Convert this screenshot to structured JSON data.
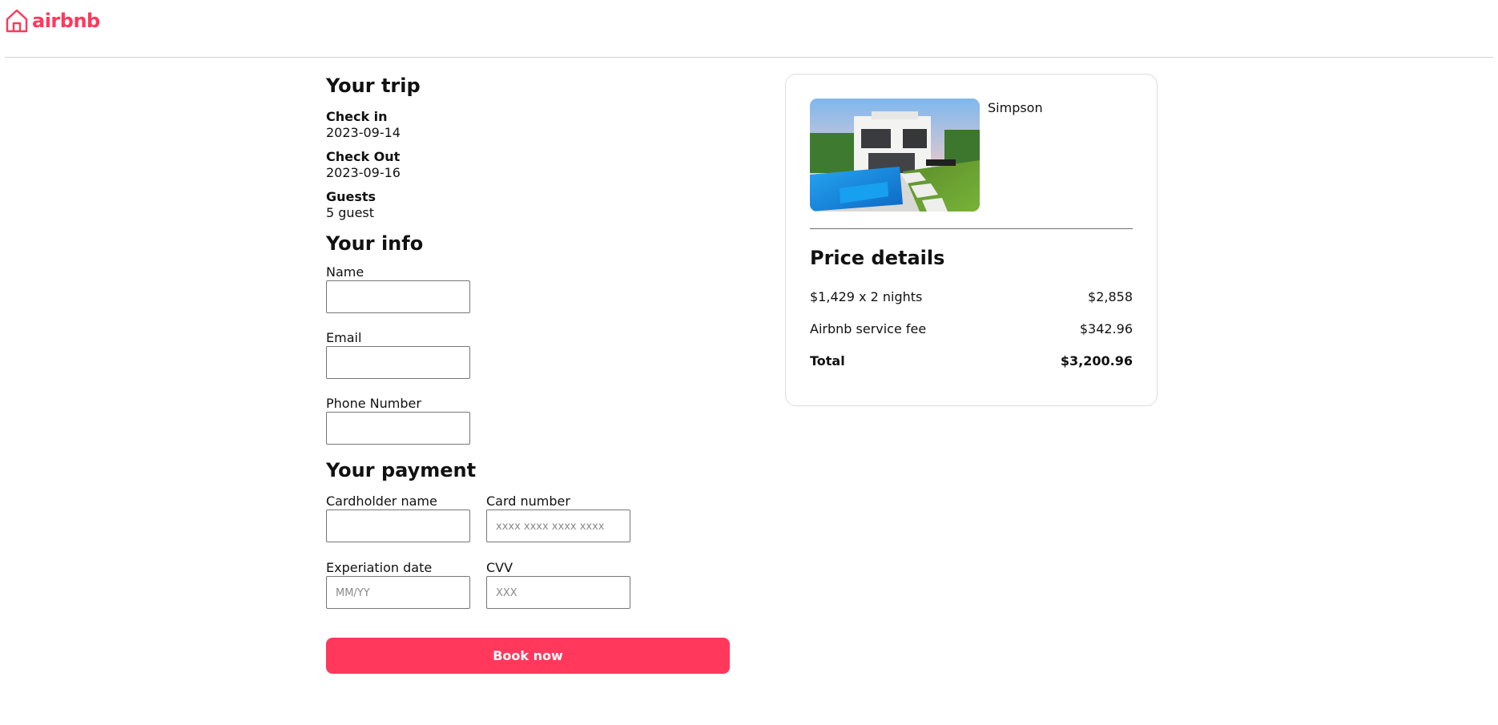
{
  "brand": {
    "name": "airbnb",
    "color": "#ff385c"
  },
  "trip": {
    "title": "Your trip",
    "check_in_label": "Check in",
    "check_in_value": "2023-09-14",
    "check_out_label": "Check Out",
    "check_out_value": "2023-09-16",
    "guests_label": "Guests",
    "guests_value": "5 guest"
  },
  "info": {
    "title": "Your info",
    "name_label": "Name",
    "name_value": "",
    "email_label": "Email",
    "email_value": "",
    "phone_label": "Phone Number",
    "phone_value": ""
  },
  "payment": {
    "title": "Your payment",
    "cardholder_label": "Cardholder name",
    "cardholder_value": "",
    "card_number_label": "Card number",
    "card_number_placeholder": "xxxx xxxx xxxx xxxx",
    "expiration_label": "Experiation date",
    "expiration_placeholder": "MM/YY",
    "cvv_label": "CVV",
    "cvv_placeholder": "XXX",
    "submit_label": "Book now"
  },
  "summary": {
    "listing_name": "Simpson",
    "price_title": "Price details",
    "rows": [
      {
        "label": "$1,429 x 2 nights",
        "amount": "$2,858"
      },
      {
        "label": "Airbnb service fee",
        "amount": "$342.96"
      }
    ],
    "total_label": "Total",
    "total_amount": "$3,200.96"
  }
}
